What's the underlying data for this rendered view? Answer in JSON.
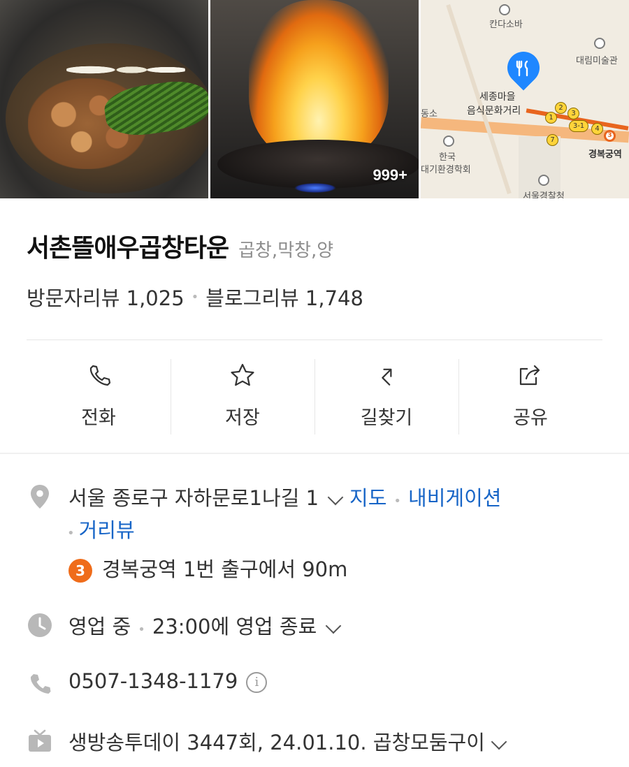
{
  "gallery": {
    "photo_count_badge": "999+",
    "map_labels": {
      "kanda_soba": "칸다소바",
      "daelim_museum": "대림미술관",
      "sejong_village_line1": "세종마을",
      "sejong_village_line2": "음식문화거리",
      "left_partial": "동소",
      "korea_line1": "한국",
      "korea_line2": "대기환경학회",
      "gyeongbokgung_station": "경복궁역",
      "police_partial": "서울경찰청",
      "exit_2": "2",
      "exit_3": "3",
      "exit_1": "1",
      "exit_3_1": "3-1",
      "exit_4": "4",
      "exit_7": "7",
      "line_3": "3"
    }
  },
  "place": {
    "name": "서촌뜰애우곱창타운",
    "category": "곱창,막창,양"
  },
  "reviews": {
    "visitor_label": "방문자리뷰",
    "visitor_count": "1,025",
    "blog_label": "블로그리뷰",
    "blog_count": "1,748"
  },
  "actions": {
    "call": "전화",
    "save": "저장",
    "directions": "길찾기",
    "share": "공유"
  },
  "info": {
    "address": "서울 종로구 자하문로1나길 1",
    "map_link": "지도",
    "navigation_link": "내비게이션",
    "roadview_link": "거리뷰",
    "subway_line": "3",
    "subway_text": "경복궁역 1번 출구에서 90m",
    "status": "영업 중",
    "hours": "23:00에 영업 종료",
    "phone": "0507-1348-1179",
    "info_glyph": "i",
    "tv_text": "생방송투데이 3447회, 24.01.10. 곱창모둠구이"
  },
  "colors": {
    "link": "#1765c7",
    "subway_line3": "#ef6c1a",
    "map_pin": "#1f87ff"
  }
}
